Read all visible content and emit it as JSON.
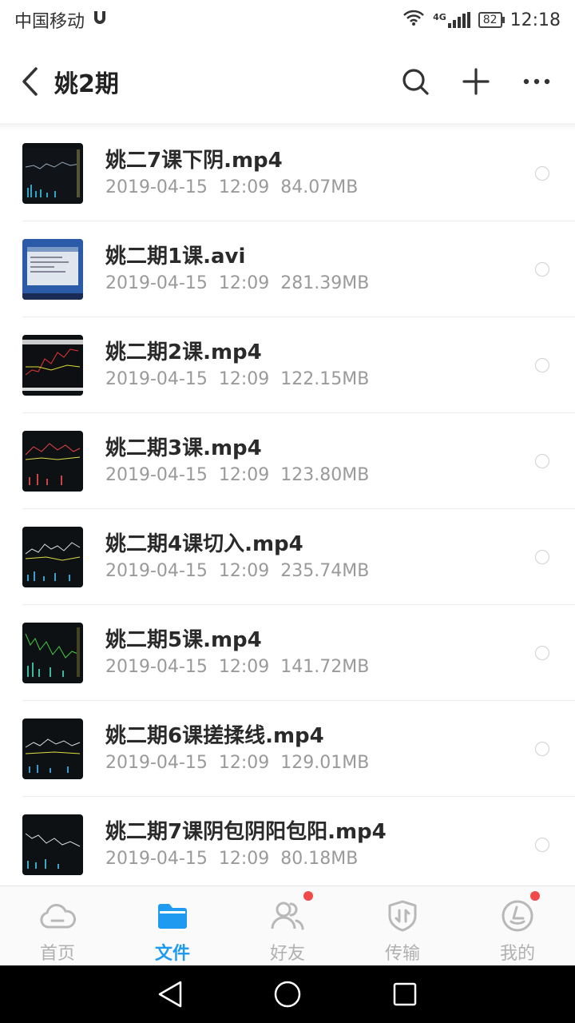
{
  "status_bar": {
    "carrier": "中国移动",
    "network": "4G",
    "battery": "82",
    "time": "12:18"
  },
  "header": {
    "title": "姚2期"
  },
  "files": [
    {
      "name": "姚二7课下阴.mp4",
      "date": "2019-04-15",
      "time": "12:09",
      "size": "84.07MB"
    },
    {
      "name": "姚二期1课.avi",
      "date": "2019-04-15",
      "time": "12:09",
      "size": "281.39MB"
    },
    {
      "name": "姚二期2课.mp4",
      "date": "2019-04-15",
      "time": "12:09",
      "size": "122.15MB"
    },
    {
      "name": "姚二期3课.mp4",
      "date": "2019-04-15",
      "time": "12:09",
      "size": "123.80MB"
    },
    {
      "name": "姚二期4课切入.mp4",
      "date": "2019-04-15",
      "time": "12:09",
      "size": "235.74MB"
    },
    {
      "name": "姚二期5课.mp4",
      "date": "2019-04-15",
      "time": "12:09",
      "size": "141.72MB"
    },
    {
      "name": "姚二期6课搓揉线.mp4",
      "date": "2019-04-15",
      "time": "12:09",
      "size": "129.01MB"
    },
    {
      "name": "姚二期7课阴包阴阳包阳.mp4",
      "date": "2019-04-15",
      "time": "12:09",
      "size": "80.18MB"
    }
  ],
  "tabs": [
    {
      "label": "首页",
      "icon": "cloud-icon",
      "active": false,
      "badge": false
    },
    {
      "label": "文件",
      "icon": "folder-icon",
      "active": true,
      "badge": false
    },
    {
      "label": "好友",
      "icon": "friends-icon",
      "active": false,
      "badge": true
    },
    {
      "label": "传输",
      "icon": "transfer-icon",
      "active": false,
      "badge": false
    },
    {
      "label": "我的",
      "icon": "profile-icon",
      "active": false,
      "badge": true
    }
  ],
  "colors": {
    "accent": "#1e9bf0",
    "badge": "#f04a4a",
    "inactive_tab": "#b0b0b0"
  }
}
